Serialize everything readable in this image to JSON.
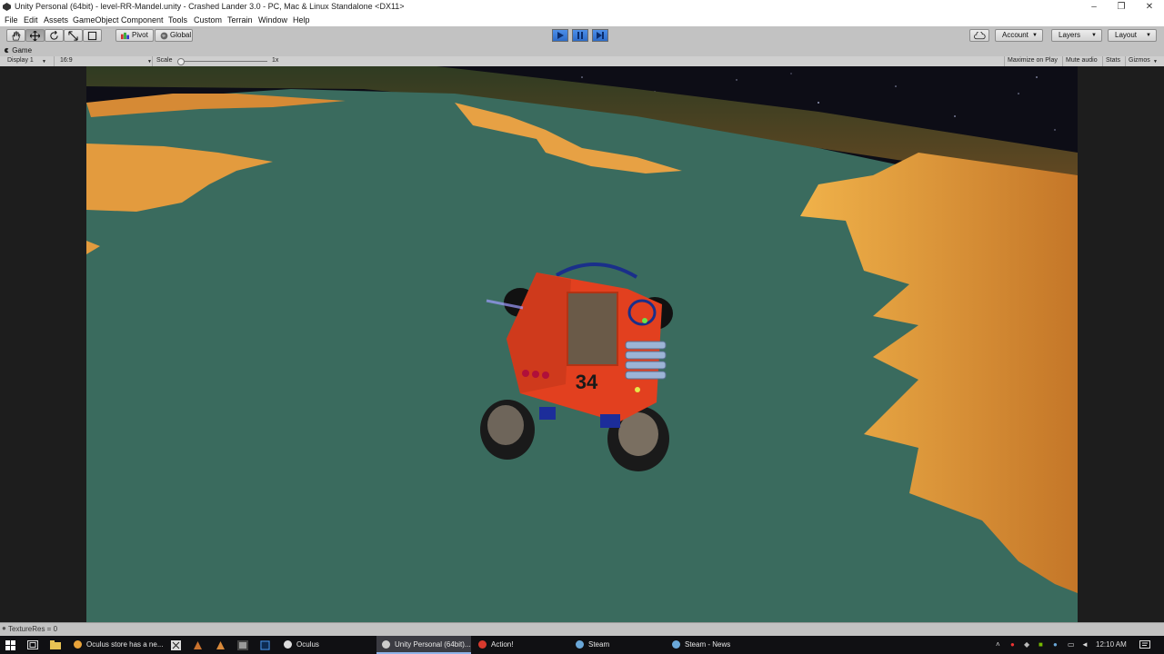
{
  "window": {
    "title": "Unity Personal (64bit) - level-RR-Mandel.unity - Crashed Lander 3.0 - PC, Mac & Linux Standalone <DX11>",
    "minimize": "–",
    "maximize": "❐",
    "close": "✕"
  },
  "menu": [
    "File",
    "Edit",
    "Assets",
    "GameObject",
    "Component",
    "Tools",
    "Custom",
    "Terrain",
    "Window",
    "Help"
  ],
  "toolbar": {
    "pivot_label": "Pivot",
    "global_label": "Global",
    "account_label": "Account",
    "layers_label": "Layers",
    "layout_label": "Layout"
  },
  "game_tab": {
    "tab_label": "Game",
    "display": "Display 1",
    "aspect": "16:9",
    "scale_label": "Scale",
    "scale_value": "1x",
    "scale_fraction": 0.0,
    "maximize_on_play": "Maximize on Play",
    "mute_audio": "Mute audio",
    "stats": "Stats",
    "gizmos": "Gizmos"
  },
  "scene": {
    "vehicle_number": "34"
  },
  "status": {
    "text": "TextureRes = 0"
  },
  "taskbar": {
    "items": [
      {
        "label": "Oculus store has a ne...",
        "color": "#e8a33a"
      },
      {
        "label": "Oculus",
        "color": "#dddddd"
      },
      {
        "label": "Unity Personal (64bit)...",
        "color": "#cccccc"
      },
      {
        "label": "Action!",
        "color": "#d83a2e"
      },
      {
        "label": "Steam",
        "color": "#6aa7d8"
      },
      {
        "label": "Steam - News",
        "color": "#6aa7d8"
      }
    ],
    "clock": "12:10 AM"
  },
  "colors": {
    "sea": "#3a6b5e",
    "land_orange": "#e29a3d",
    "vehicle_red": "#e2401f",
    "play_blue": "#3a7bd5",
    "editor_gray": "#c2c2c2"
  }
}
